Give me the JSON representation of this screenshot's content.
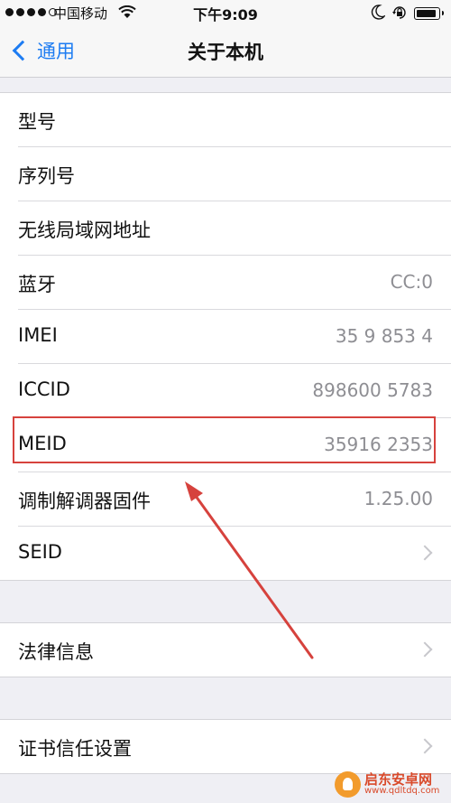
{
  "status_bar": {
    "carrier": "中国移动",
    "time": "下午9:09",
    "signal_filled": 4,
    "signal_total": 5,
    "battery_level": 0.9,
    "icons": [
      "wifi-icon",
      "moon-icon",
      "rotation-lock-icon",
      "battery-icon"
    ]
  },
  "nav": {
    "back_label": "通用",
    "title": "关于本机"
  },
  "info_rows": [
    {
      "label": "型号",
      "value": ""
    },
    {
      "label": "序列号",
      "value": ""
    },
    {
      "label": "无线局域网地址",
      "value": ""
    },
    {
      "label": "蓝牙",
      "value": "CC:0"
    },
    {
      "label": "IMEI",
      "value": "35 9 853 4"
    },
    {
      "label": "ICCID",
      "value": "898600 5783"
    },
    {
      "label": "MEID",
      "value": "35916 2353"
    },
    {
      "label": "调制解调器固件",
      "value": "1.25.00"
    },
    {
      "label": "SEID",
      "value": ""
    }
  ],
  "legal_group": {
    "label": "法律信息"
  },
  "cert_group": {
    "label": "证书信任设置"
  },
  "watermark": {
    "name": "启东安卓网",
    "url": "www.qdltdq.com"
  },
  "colors": {
    "accent": "#1d7cf2",
    "highlight": "#d6423d",
    "secondary_text": "#8e8e93"
  }
}
